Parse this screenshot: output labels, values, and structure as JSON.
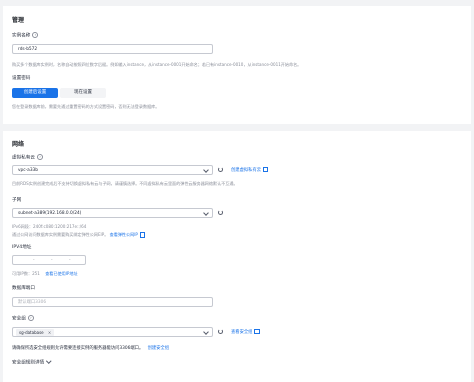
{
  "management": {
    "title": "管理",
    "instance_name": {
      "label": "实例名称",
      "value": "rds-b572",
      "hint": "购买多个数据库实例时，名称自动按照四位数字后缀。例如输入instance，从instance-0001开始命名；若已有instance-0010，从instance-0011开始命名。"
    },
    "password": {
      "label": "设置密码",
      "options": [
        "创建后设置",
        "现在设置"
      ],
      "selected": "创建后设置",
      "hint": "您在登录数据库前，需要先通过重置密码的方式设置密码，否则无法登录数据库。"
    }
  },
  "network": {
    "title": "网络",
    "vpc": {
      "label": "虚拟私有云",
      "value": "vpc-a33b",
      "create_link": "创建虚拟私有云",
      "hint": "目前RDS实例创建完成后不支持切换虚拟私有云与子网，请谨慎选择。不同虚拟私有云里面的弹性云服务器网络默认不互通。"
    },
    "subnet": {
      "label": "子网",
      "value": "subnet-a389(192.168.0.0/24)",
      "link": "查看弹性公网IP",
      "ipv6_hint": "IPv6网段：240f:c080:1200:217e::/64",
      "public_hint": "通过公网访问数据库实例需要购买绑定弹性公网EIP。"
    },
    "ipv4": {
      "label": "IPV4地址",
      "segments": [
        "-",
        "-",
        "-"
      ],
      "available_label": "可用IP数：",
      "available_value": "251",
      "link": "查看已使用IP地址"
    },
    "port": {
      "label": "数据库端口",
      "placeholder": "默认端口3306"
    },
    "security_group": {
      "label": "安全组",
      "tag": "sg-database",
      "tag_close": "×",
      "link": "查看安全组",
      "hint": "请确保所选安全组规则允许需要连接实例的服务器能访问3306端口。",
      "hint_link": "创建安全组"
    },
    "rules_toggle": "安全组规则详情"
  },
  "colors": {
    "accent": "#1a73e8",
    "page_bg": "#f2f3f5"
  }
}
